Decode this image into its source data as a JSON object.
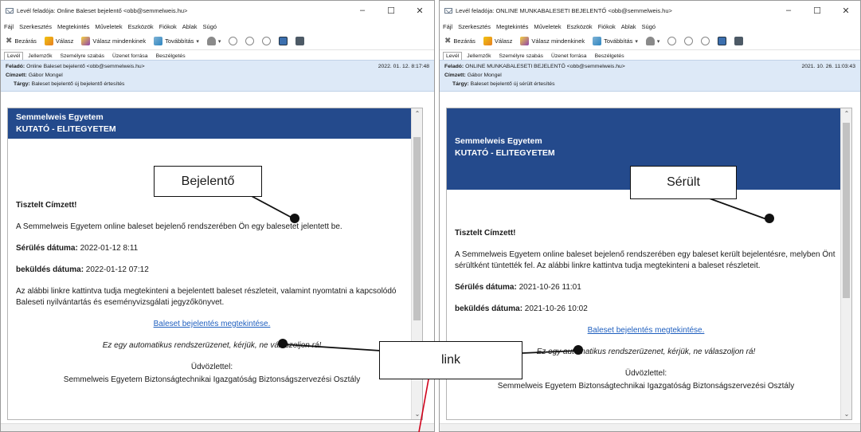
{
  "left": {
    "title": "Levél feladója: Online Baleset bejelentő <obb@semmelweis.hu>",
    "window_controls": [
      "–",
      "☐",
      "✕"
    ],
    "menu": [
      "Fájl",
      "Szerkesztés",
      "Megtekintés",
      "Műveletek",
      "Eszközök",
      "Fiókok",
      "Ablak",
      "Súgó"
    ],
    "toolbar": {
      "close": "Bezárás",
      "reply": "Válasz",
      "reply_all": "Válasz mindenkinek",
      "forward": "Továbbítás"
    },
    "tabs": [
      "Levél",
      "Jellemzők",
      "Személyre szabás",
      "Üzenet forrása",
      "Beszélgetés"
    ],
    "header": {
      "from_label": "Feladó:",
      "from": "Online Baleset bejelentő <obb@semmelweis.hu>",
      "to_label": "Címzett:",
      "to": "Gábor Mongel",
      "subject_label": "Tárgy:",
      "subject": "Baleset bejelentő új bejelentő értesítés",
      "date": "2022. 01. 12. 8:17:48"
    },
    "banner": {
      "line1": "Semmelweis Egyetem",
      "line2": "KUTATÓ - ELITEGYETEM"
    },
    "body": {
      "greeting": "Tisztelt Címzett!",
      "p1": "A Semmelweis Egyetem online baleset bejelenő rendszerében Ön egy balesetet jelentett be.",
      "injury_label": "Sérülés dátuma:",
      "injury_value": " 2022-01-12 8:11",
      "sent_label": "beküldés dátuma:",
      "sent_value": " 2022-01-12 07:12",
      "p2": "Az alábbi linkre kattintva tudja megtekinteni a bejelentett baleset részleteit, valamint nyomtatni a kapcsolódó Baleseti nyilvántartás és eseményvizsgálati jegyzőkönyvet.",
      "link": "Baleset bejelentés megtekintése.",
      "auto": "Ez egy automatikus rendszerüzenet, kérjük, ne válaszoljon rá!",
      "regards": "Üdvözlettel:",
      "signature": "Semmelweis Egyetem Biztonságtechnikai Igazgatóság Biztonságszervezési Osztály"
    }
  },
  "right": {
    "title": "Levél feladója: ONLINE MUNKABALESETI BEJELENTŐ <obb@semmelweis.hu>",
    "window_controls": [
      "–",
      "☐",
      "✕"
    ],
    "menu": [
      "Fájl",
      "Szerkesztés",
      "Megtekintés",
      "Műveletek",
      "Eszközök",
      "Fiókok",
      "Ablak",
      "Súgó"
    ],
    "toolbar": {
      "close": "Bezárás",
      "reply": "Válasz",
      "reply_all": "Válasz mindenkinek",
      "forward": "Továbbítás"
    },
    "tabs": [
      "Levél",
      "Jellemzők",
      "Személyre szabás",
      "Üzenet forrása",
      "Beszélgetés"
    ],
    "header": {
      "from_label": "Feladó:",
      "from": "ONLINE MUNKABALESETI BEJELENTŐ <obb@semmelweis.hu>",
      "to_label": "Címzett:",
      "to": "Gábor Mongel",
      "subject_label": "Tárgy:",
      "subject": "Baleset bejelentő új sérült értesítés",
      "date": "2021. 10. 26. 11:03:43"
    },
    "banner": {
      "line1": "Semmelweis Egyetem",
      "line2": "KUTATÓ - ELITEGYETEM"
    },
    "body": {
      "greeting": "Tisztelt Címzett!",
      "p1": "A Semmelweis Egyetem online baleset bejelenő rendszerében egy baleset került bejelentésre, melyben Önt sérültként tüntették fel. Az alábbi linkre kattintva tudja megtekinteni a baleset részleteit.",
      "injury_label": "Sérülés dátuma:",
      "injury_value": " 2021-10-26 11:01",
      "sent_label": "beküldés dátuma:",
      "sent_value": " 2021-10-26 10:02",
      "link": "Baleset bejelentés megtekintése.",
      "auto": "Ez egy automatikus rendszerüzenet, kérjük, ne válaszoljon rá!",
      "regards": "Üdvözlettel:",
      "signature": "Semmelweis Egyetem Biztonságtechnikai Igazgatóság Biztonságszervezési Osztály"
    }
  },
  "callouts": {
    "reporter": "Bejelentő",
    "injured": "Sérült",
    "link": "link"
  },
  "colors": {
    "banner": "#244a8c",
    "header_bg": "#dde9f7",
    "link": "#1f5fbf",
    "arrow": "#d0021b"
  }
}
